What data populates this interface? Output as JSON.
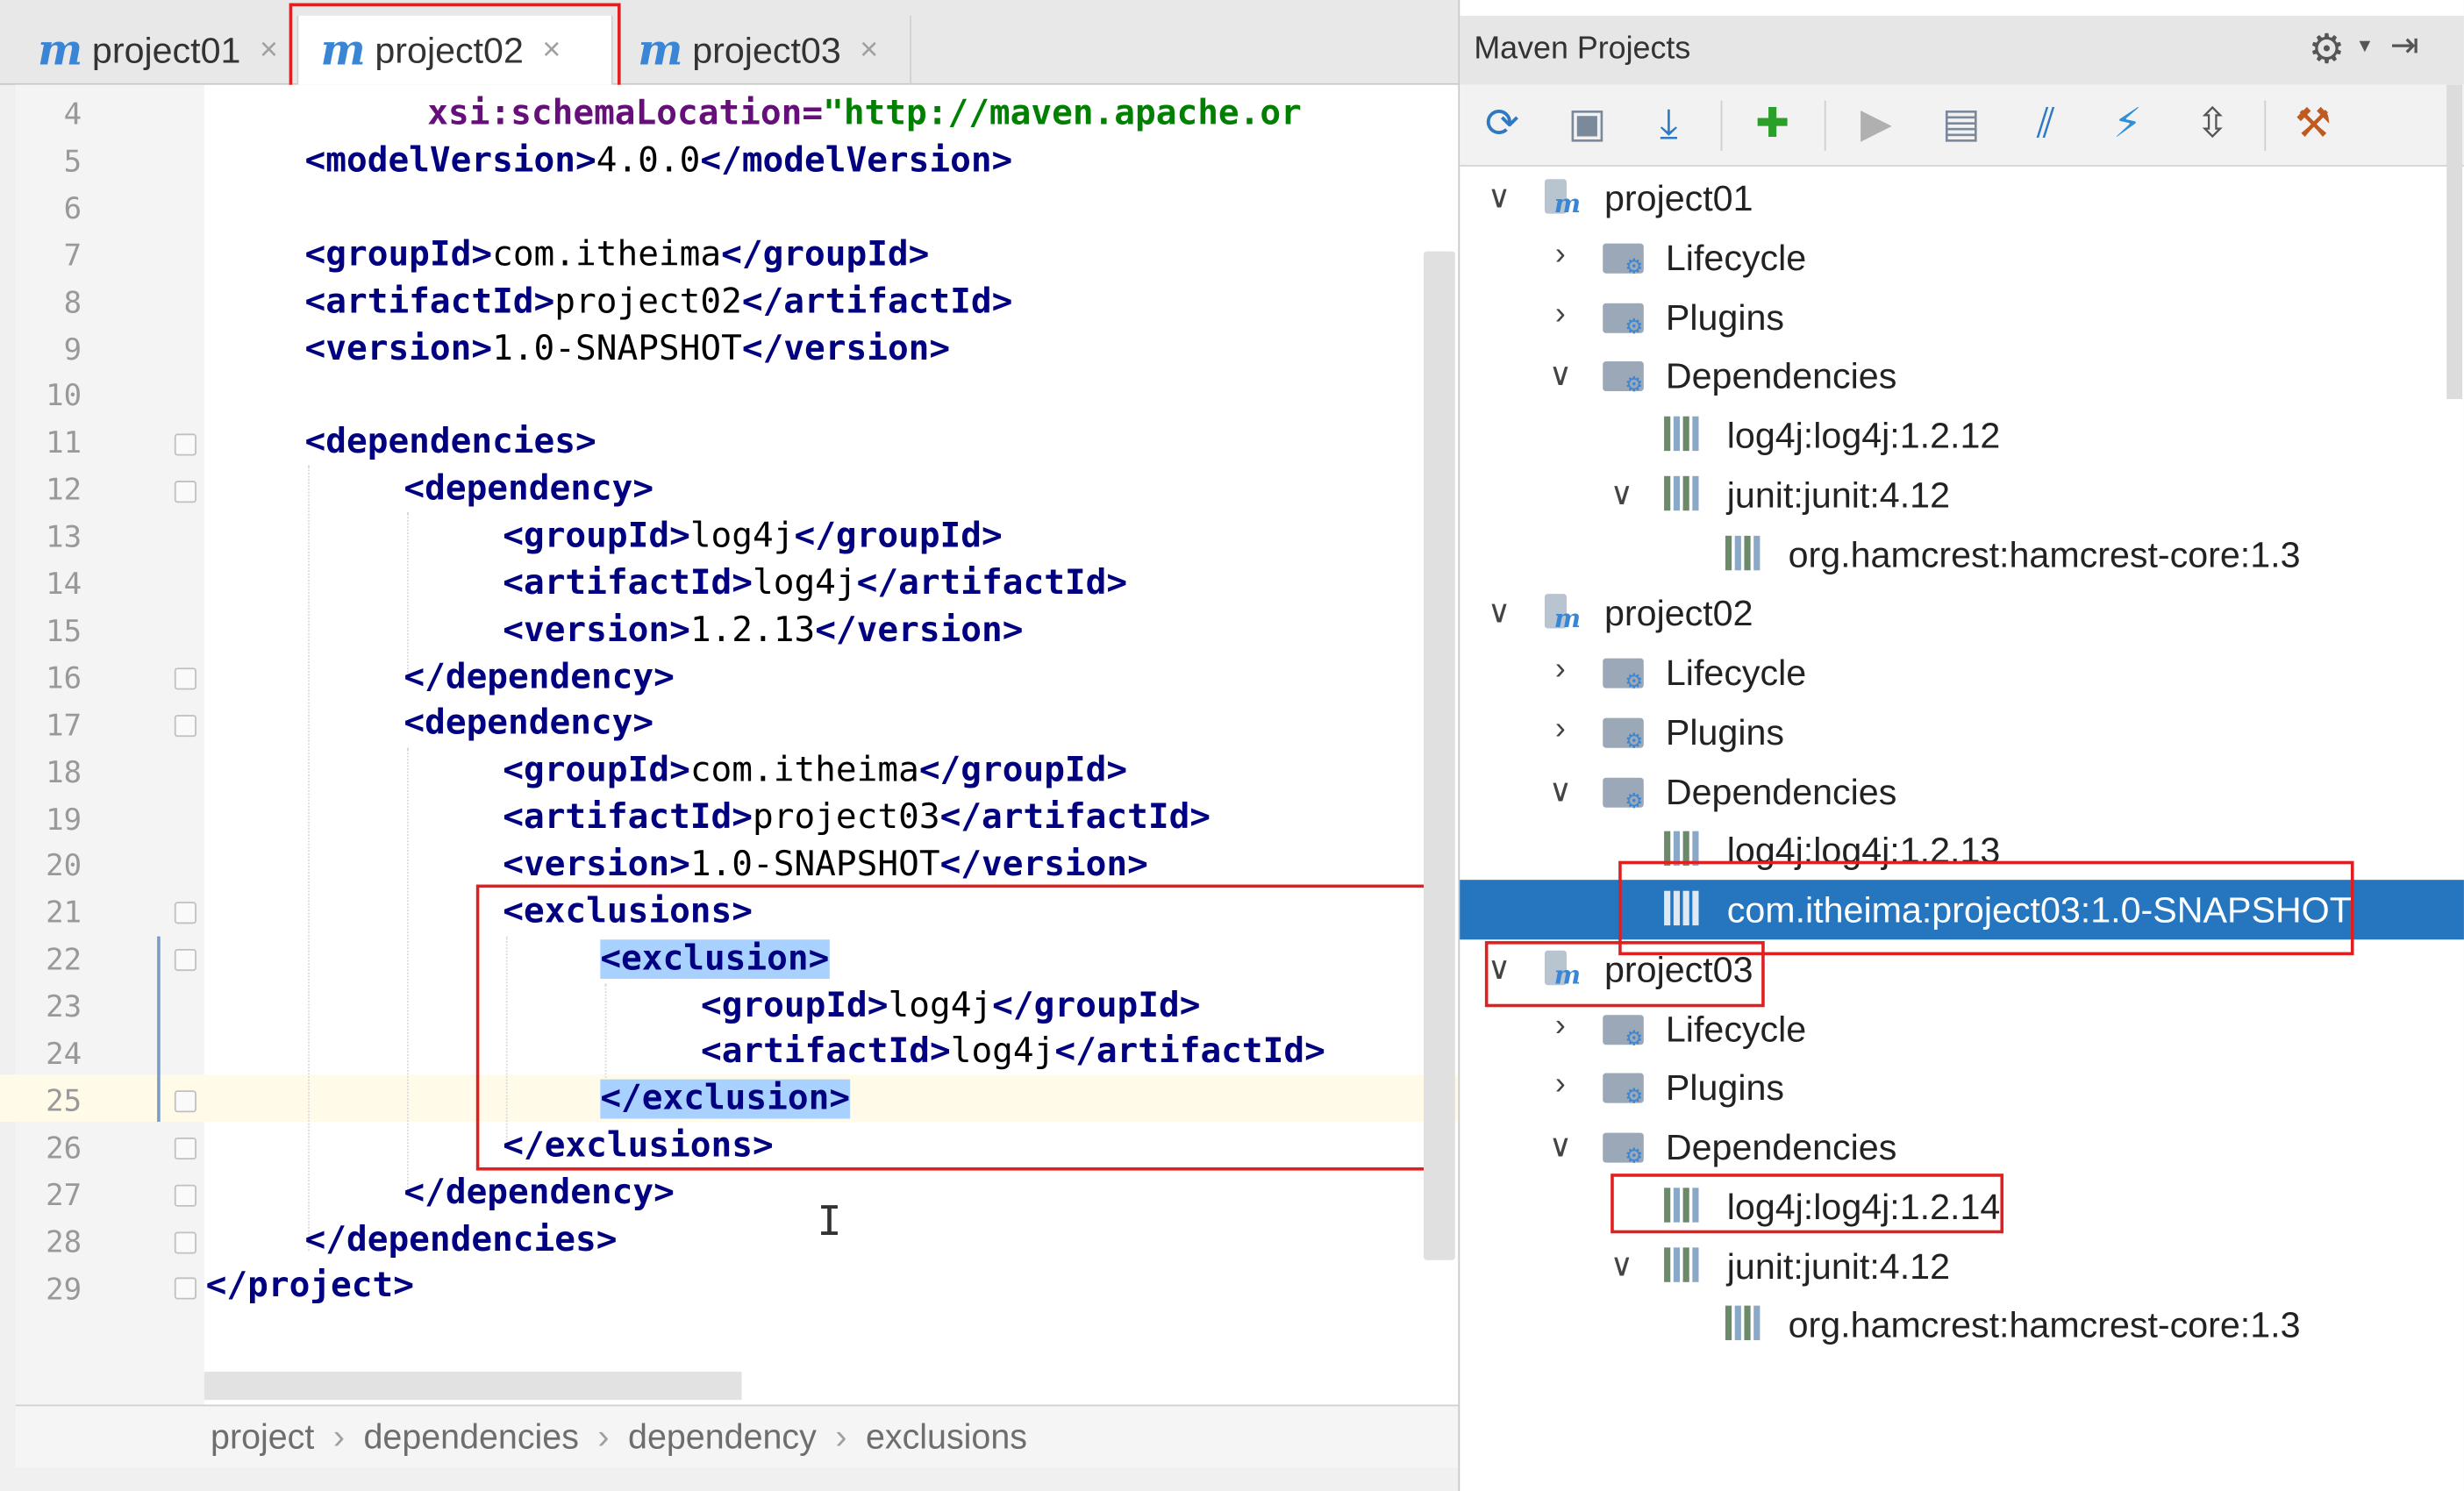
{
  "tabs": [
    {
      "label": "project01",
      "icon": "maven-m-icon",
      "close": "×"
    },
    {
      "label": "project02",
      "icon": "maven-m-icon",
      "close": "×"
    },
    {
      "label": "project03",
      "icon": "maven-m-icon",
      "close": "×"
    }
  ],
  "editor": {
    "line_numbers": [
      "4",
      "5",
      "6",
      "7",
      "8",
      "9",
      "10",
      "11",
      "12",
      "13",
      "14",
      "15",
      "16",
      "17",
      "18",
      "19",
      "20",
      "21",
      "22",
      "23",
      "24",
      "25",
      "26",
      "27",
      "28",
      "29"
    ],
    "lines": {
      "l4_attr": "xsi:schemaLocation=",
      "l4_val": "\"http://maven.apache.or",
      "l5": [
        "<modelVersion>",
        "4.0.0",
        "</modelVersion>"
      ],
      "l7": [
        "<groupId>",
        "com.itheima",
        "</groupId>"
      ],
      "l8": [
        "<artifactId>",
        "project02",
        "</artifactId>"
      ],
      "l9": [
        "<version>",
        "1.0-SNAPSHOT",
        "</version>"
      ],
      "l11": "<dependencies>",
      "l12": "<dependency>",
      "l13": [
        "<groupId>",
        "log4j",
        "</groupId>"
      ],
      "l14": [
        "<artifactId>",
        "log4j",
        "</artifactId>"
      ],
      "l15": [
        "<version>",
        "1.2.13",
        "</version>"
      ],
      "l16": "</dependency>",
      "l17": "<dependency>",
      "l18": [
        "<groupId>",
        "com.itheima",
        "</groupId>"
      ],
      "l19": [
        "<artifactId>",
        "project03",
        "</artifactId>"
      ],
      "l20": [
        "<version>",
        "1.0-SNAPSHOT",
        "</version>"
      ],
      "l21": "<exclusions>",
      "l22": "<exclusion>",
      "l23": [
        "<groupId>",
        "log4j",
        "</groupId>"
      ],
      "l24": [
        "<artifactId>",
        "log4j",
        "</artifactId>"
      ],
      "l25": "</exclusion>",
      "l26": "</exclusions>",
      "l27": "</dependency>",
      "l28": "</dependencies>",
      "l29": "</project>"
    }
  },
  "breadcrumb": [
    "project",
    "dependencies",
    "dependency",
    "exclusions"
  ],
  "breadcrumb_sep": "›",
  "maven": {
    "title": "Maven Projects",
    "tree": [
      {
        "label": "project01",
        "chev": "∨"
      },
      {
        "label": "Lifecycle",
        "chev": "›"
      },
      {
        "label": "Plugins",
        "chev": "›"
      },
      {
        "label": "Dependencies",
        "chev": "∨"
      },
      {
        "label": "log4j:log4j:1.2.12",
        "chev": ""
      },
      {
        "label": "junit:junit:4.12",
        "chev": "∨"
      },
      {
        "label": "org.hamcrest:hamcrest-core:1.3",
        "chev": ""
      },
      {
        "label": "project02",
        "chev": "∨"
      },
      {
        "label": "Lifecycle",
        "chev": "›"
      },
      {
        "label": "Plugins",
        "chev": "›"
      },
      {
        "label": "Dependencies",
        "chev": "∨"
      },
      {
        "label": "log4j:log4j:1.2.13",
        "chev": ""
      },
      {
        "label": "com.itheima:project03:1.0-SNAPSHOT",
        "chev": ""
      },
      {
        "label": "project03",
        "chev": "∨"
      },
      {
        "label": "Lifecycle",
        "chev": "›"
      },
      {
        "label": "Plugins",
        "chev": "›"
      },
      {
        "label": "Dependencies",
        "chev": "∨"
      },
      {
        "label": "log4j:log4j:1.2.14",
        "chev": ""
      },
      {
        "label": "junit:junit:4.12",
        "chev": "∨"
      },
      {
        "label": "org.hamcrest:hamcrest-core:1.3",
        "chev": ""
      }
    ]
  },
  "colors": {
    "accent": "#2675bf",
    "highlight_border": "#e02020",
    "tag": "#000080",
    "attr_value": "#008000"
  }
}
